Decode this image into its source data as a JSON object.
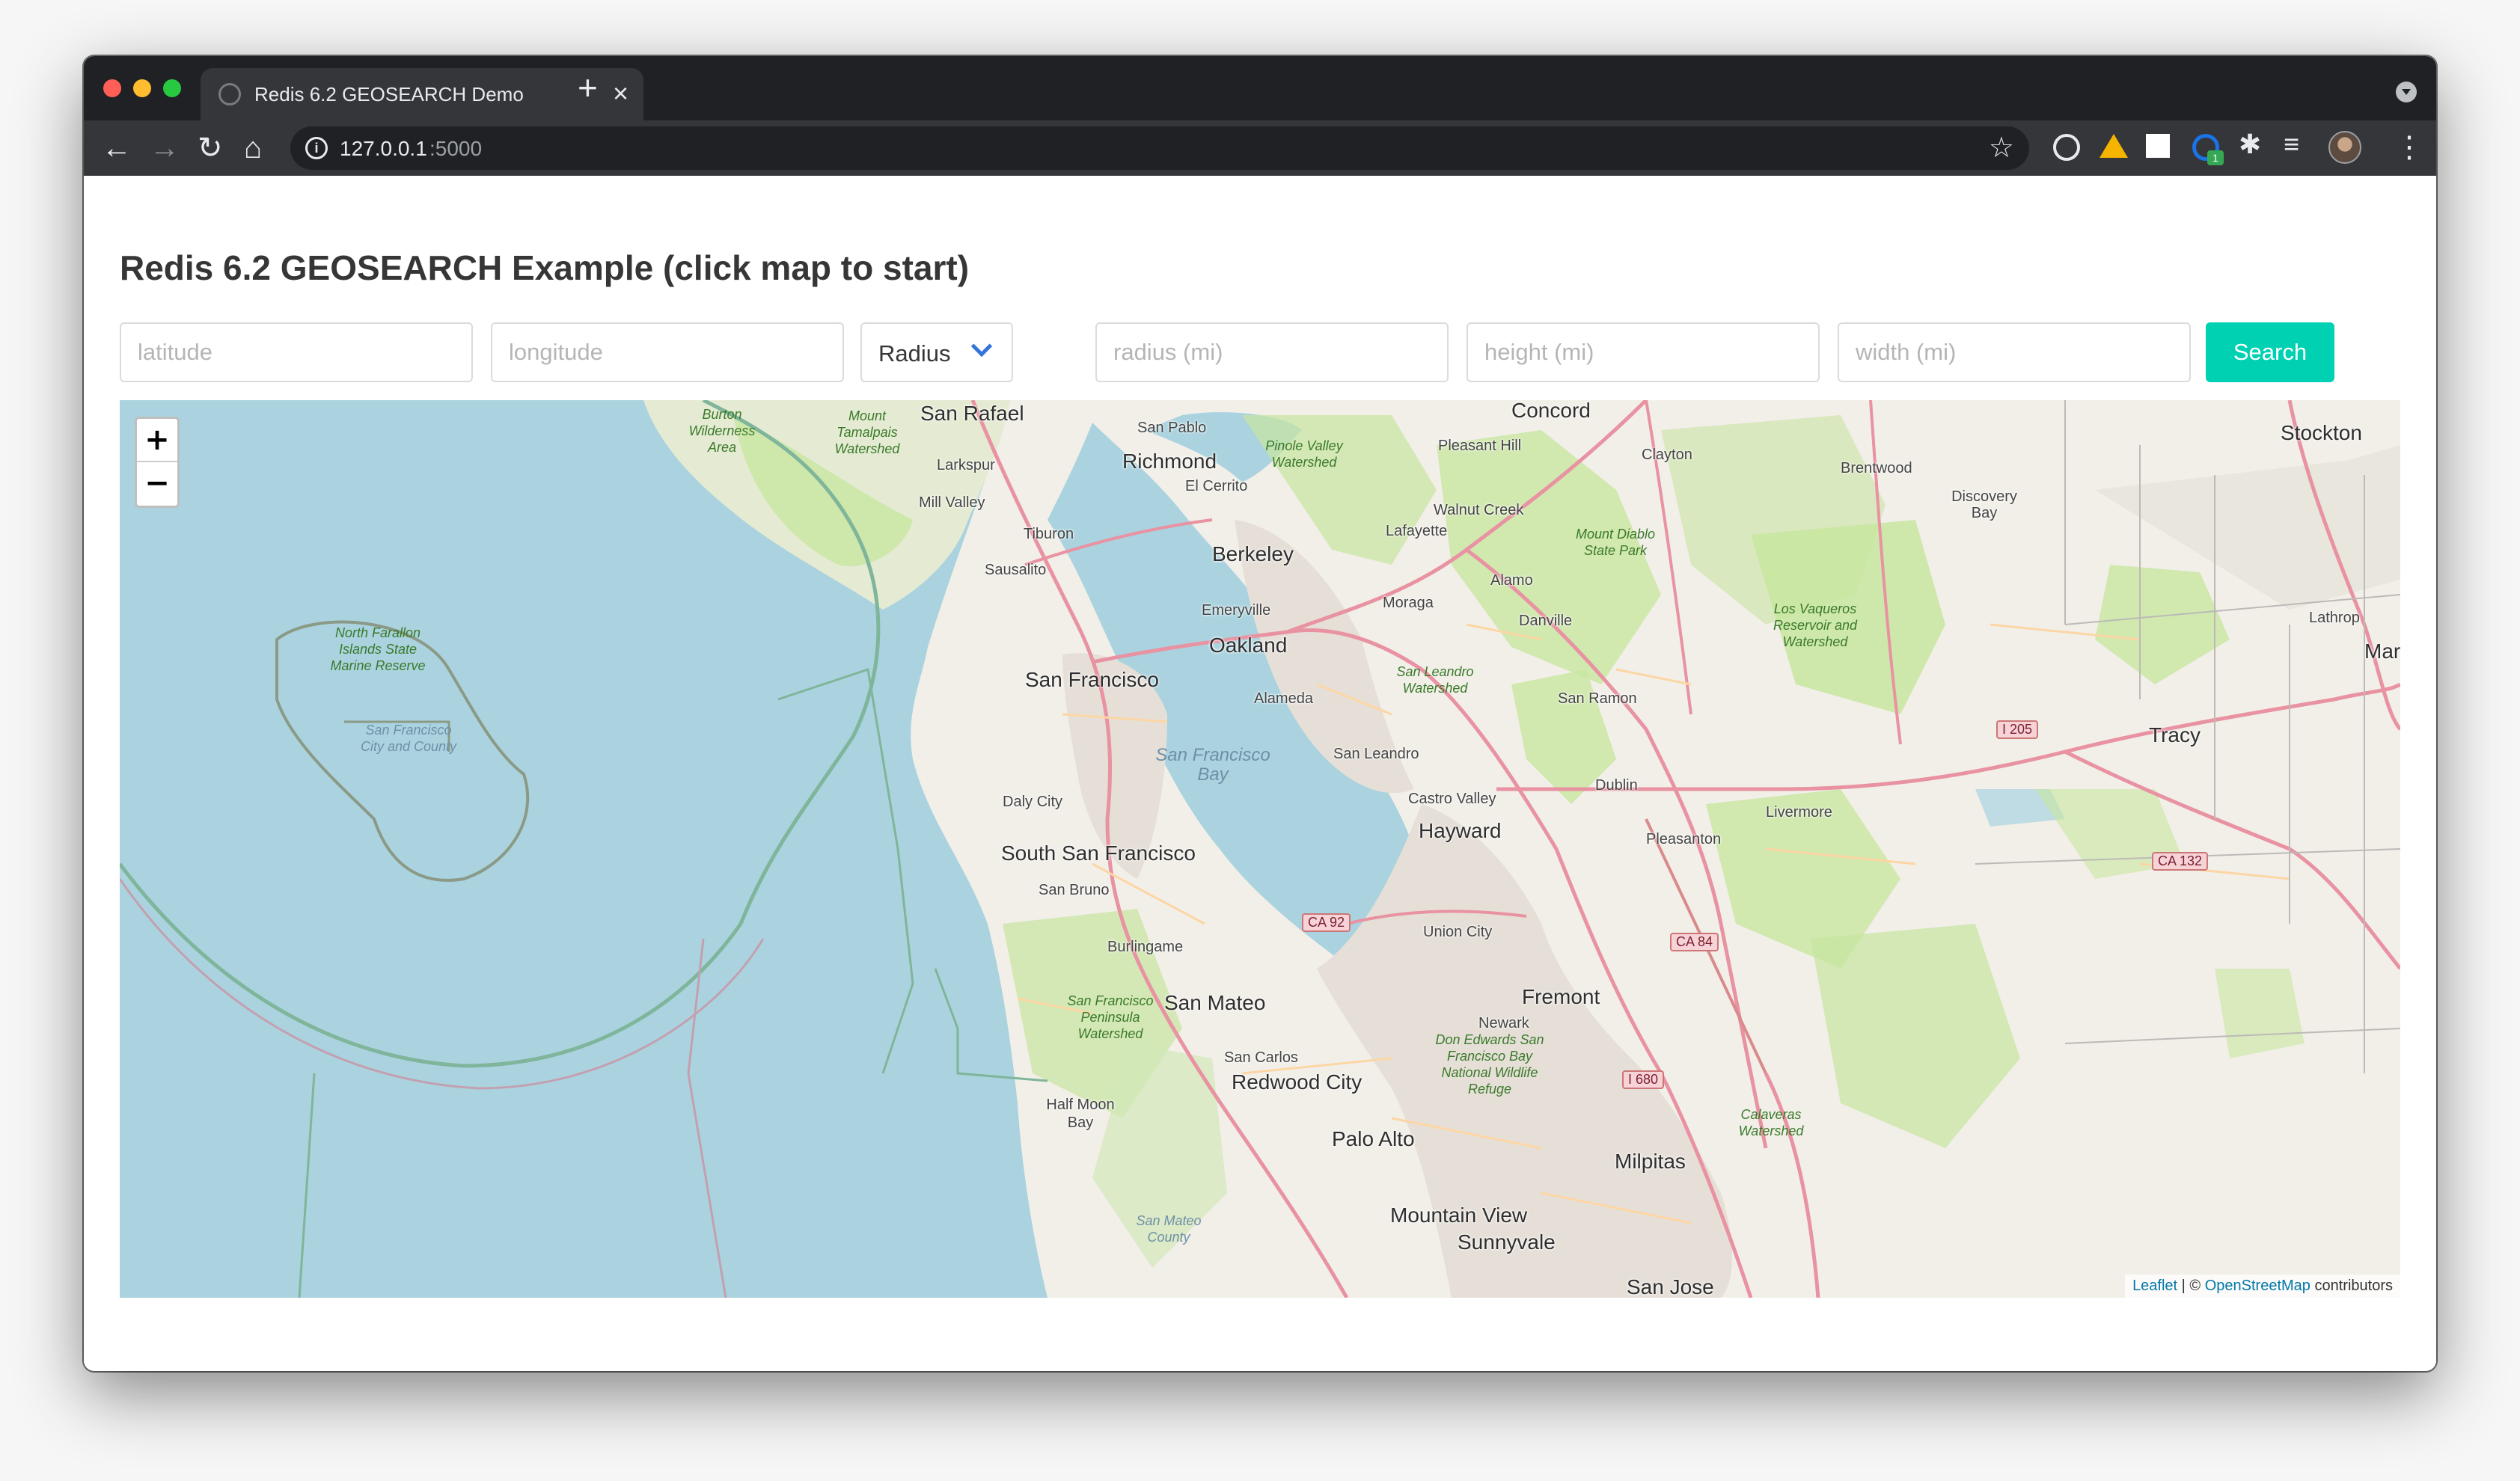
{
  "browser": {
    "tab_title": "Redis 6.2 GEOSEARCH Demo",
    "tab_close": "×",
    "new_tab": "+",
    "url_host": "127.0.0.1",
    "url_port": ":5000",
    "back": "←",
    "forward": "→",
    "reload": "↻",
    "home": "⌂",
    "bookmark": "☆",
    "menu": "⋮",
    "extension_badge": "1",
    "icons": [
      "info-icon",
      "star-icon",
      "chrome-extension-icon",
      "google-drive-icon",
      "extension-icon",
      "puzzle-icon",
      "media-control-icon",
      "profile-avatar",
      "menu-icon"
    ]
  },
  "page": {
    "title": "Redis 6.2 GEOSEARCH Example (click map to start)",
    "inputs": {
      "latitude_placeholder": "latitude",
      "longitude_placeholder": "longitude",
      "shape_select_value": "Radius",
      "radius_placeholder": "radius (mi)",
      "height_placeholder": "height (mi)",
      "width_placeholder": "width (mi)"
    },
    "search_label": "Search",
    "colors": {
      "primary": "#00d1b2",
      "select_arrow": "#3273dc",
      "water": "#aad3df",
      "land": "#f2efe9",
      "park": "#c8e6a0"
    }
  },
  "map": {
    "zoom_in": "+",
    "zoom_out": "−",
    "attribution": {
      "leaflet": "Leaflet",
      "separator": " | © ",
      "osm": "OpenStreetMap",
      "suffix": " contributors"
    },
    "labels": {
      "san_rafael": "San Rafael",
      "concord": "Concord",
      "stockton": "Stockton",
      "san_pablo": "San Pablo",
      "richmond": "Richmond",
      "el_cerrito": "El Cerrito",
      "pleasant_hill": "Pleasant Hill",
      "clayton": "Clayton",
      "brentwood": "Brentwood",
      "discovery_bay": "Discovery Bay",
      "larkspur": "Larkspur",
      "mill_valley": "Mill Valley",
      "tiburon": "Tiburon",
      "sausalito": "Sausalito",
      "lafayette": "Lafayette",
      "walnut_creek": "Walnut Creek",
      "berkeley": "Berkeley",
      "emeryville": "Emeryville",
      "oakland": "Oakland",
      "moraga": "Moraga",
      "alamo": "Alamo",
      "danville": "Danville",
      "lathrop": "Lathrop",
      "manteca": "Mar",
      "san_francisco": "San Francisco",
      "alameda": "Alameda",
      "san_ramon": "San Ramon",
      "san_leandro": "San Leandro",
      "tracy": "Tracy",
      "castro_valley": "Castro Valley",
      "dublin": "Dublin",
      "livermore": "Livermore",
      "daly_city": "Daly City",
      "hayward": "Hayward",
      "pleasanton": "Pleasanton",
      "south_san_francisco": "South San Francisco",
      "san_bruno": "San Bruno",
      "union_city": "Union City",
      "burlingame": "Burlingame",
      "fremont": "Fremont",
      "san_mateo": "San Mateo",
      "newark": "Newark",
      "san_carlos": "San Carlos",
      "redwood_city": "Redwood City",
      "half_moon_bay": "Half Moon Bay",
      "palo_alto": "Palo Alto",
      "milpitas": "Milpitas",
      "mountain_view": "Mountain View",
      "sunnyvale": "Sunnyvale",
      "san_jose": "San Jose",
      "burton_wilderness": "Burton Wilderness Area",
      "mount_tamalpais": "Mount Tamalpais Watershed",
      "pinole_valley": "Pinole Valley Watershed",
      "mount_diablo": "Mount Diablo State Park",
      "los_vaqueros": "Los Vaqueros Reservoir and Watershed",
      "san_leandro_ws": "San Leandro Watershed",
      "north_farallon": "North Farallon Islands State Marine Reserve",
      "sf_city_county": "San Francisco City and County",
      "sf_bay": "San Francisco Bay",
      "sf_peninsula": "San Francisco Peninsula Watershed",
      "don_edwards": "Don Edwards San Francisco Bay National Wildlife Refuge",
      "calaveras": "Calaveras Watershed",
      "san_mateo_county": "San Mateo County",
      "i205": "I 205",
      "ca132": "CA 132",
      "ca92": "CA 92",
      "ca84": "CA 84",
      "i680": "I 680"
    }
  }
}
